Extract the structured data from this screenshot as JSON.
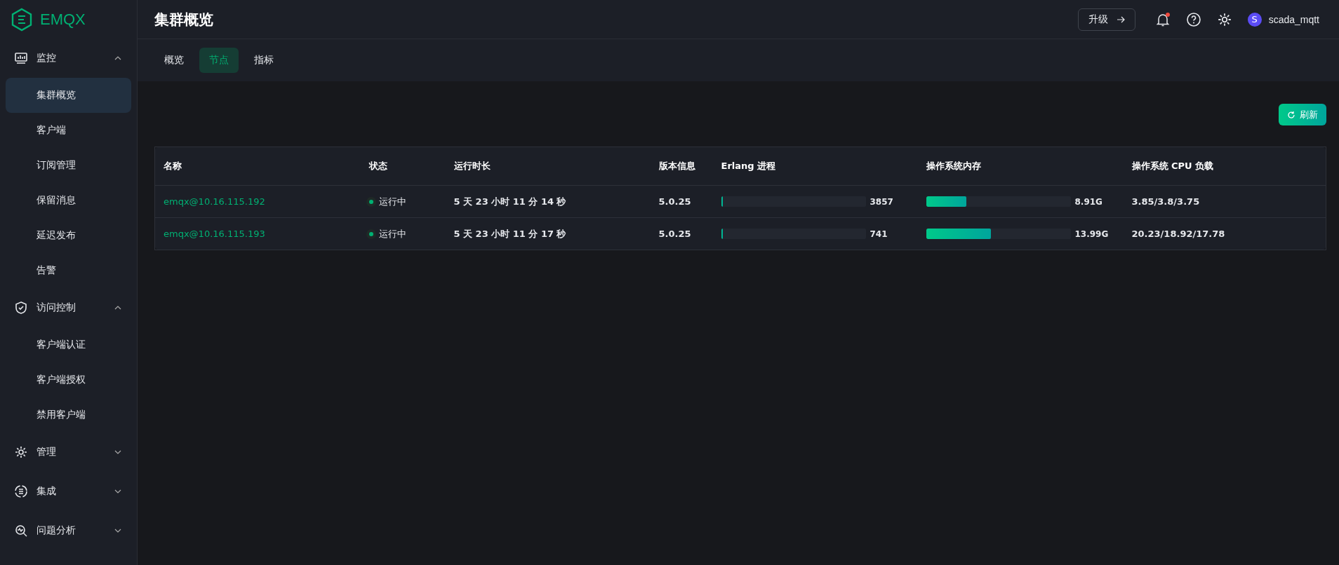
{
  "logo": {
    "text": "EMQX"
  },
  "sidebar": {
    "groups": [
      {
        "label": "监控",
        "expanded": true,
        "items": [
          {
            "label": "集群概览",
            "selected": true
          },
          {
            "label": "客户端",
            "selected": false
          },
          {
            "label": "订阅管理",
            "selected": false
          },
          {
            "label": "保留消息",
            "selected": false
          },
          {
            "label": "延迟发布",
            "selected": false
          },
          {
            "label": "告警",
            "selected": false
          }
        ]
      },
      {
        "label": "访问控制",
        "expanded": true,
        "items": [
          {
            "label": "客户端认证",
            "selected": false
          },
          {
            "label": "客户端授权",
            "selected": false
          },
          {
            "label": "禁用客户端",
            "selected": false
          }
        ]
      },
      {
        "label": "管理",
        "expanded": false
      },
      {
        "label": "集成",
        "expanded": false
      },
      {
        "label": "问题分析",
        "expanded": false
      }
    ]
  },
  "header": {
    "title": "集群概览",
    "upgrade_button": "升级",
    "notifications_unread": true,
    "user": {
      "avatar": "S",
      "name": "scada_mqtt"
    }
  },
  "tabs": [
    {
      "label": "概览",
      "selected": false
    },
    {
      "label": "节点",
      "selected": true
    },
    {
      "label": "指标",
      "selected": false
    }
  ],
  "refresh_button": "刷新",
  "table": {
    "columns": [
      "名称",
      "状态",
      "运行时长",
      "版本信息",
      "Erlang 进程",
      "操作系统内存",
      "操作系统 CPU 负载"
    ],
    "rows": [
      {
        "name": "emqx@10.16.115.192",
        "status": "运行中",
        "running": true,
        "uptime": "5 天 23 小时 11 分 14 秒",
        "version": "5.0.25",
        "erlang": {
          "level": 0.01,
          "reading": "3857"
        },
        "memory": {
          "level": 0.28,
          "reading": "8.91G"
        },
        "cpu": "3.85/3.8/3.75"
      },
      {
        "name": "emqx@10.16.115.193",
        "status": "运行中",
        "running": true,
        "uptime": "5 天 23 小时 11 分 17 秒",
        "version": "5.0.25",
        "erlang": {
          "level": 0.01,
          "reading": "741"
        },
        "memory": {
          "level": 0.45,
          "reading": "13.99G"
        },
        "cpu": "20.23/18.92/17.78"
      }
    ]
  }
}
